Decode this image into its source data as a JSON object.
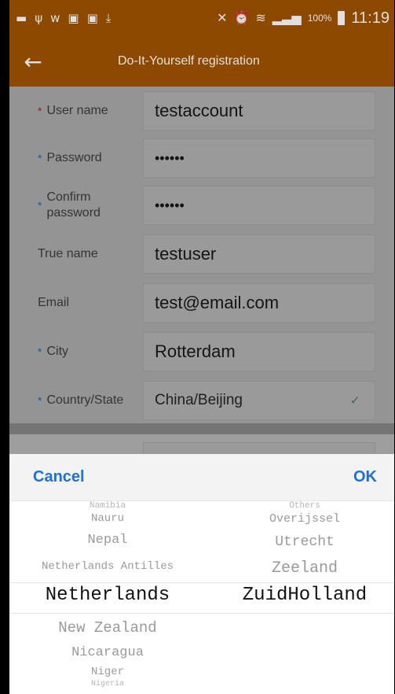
{
  "status_bar": {
    "left_icons": [
      "message-icon",
      "usb-icon",
      "wifi-icon",
      "image-icon",
      "image-icon",
      "download-icon"
    ],
    "battery": "100%",
    "time": "11:19"
  },
  "app_bar": {
    "title": "Do-It-Yourself registration"
  },
  "form": {
    "fields": [
      {
        "label": "User name",
        "required": true,
        "value": "testaccount"
      },
      {
        "label": "Password",
        "required": true,
        "value": "••••••"
      },
      {
        "label": "Confirm password",
        "required": true,
        "value": "••••••"
      },
      {
        "label": "True name",
        "required": false,
        "value": "testuser"
      },
      {
        "label": "Email",
        "required": false,
        "value": "test@email.com"
      },
      {
        "label": "City",
        "required": true,
        "value": "Rotterdam"
      },
      {
        "label": "Country/State",
        "required": true,
        "value": "China/Beijing"
      }
    ]
  },
  "picker": {
    "cancel_label": "Cancel",
    "ok_label": "OK",
    "countries": [
      "Namibia",
      "Nauru",
      "Nepal",
      "Netherlands Antilles",
      "Netherlands",
      "New Zealand",
      "Nicaragua",
      "Niger",
      "Nigeria"
    ],
    "selected_country": "Netherlands",
    "regions": [
      "Others",
      "Overijssel",
      "Utrecht",
      "Zeeland",
      "ZuidHolland"
    ],
    "selected_region": "ZuidHolland"
  }
}
